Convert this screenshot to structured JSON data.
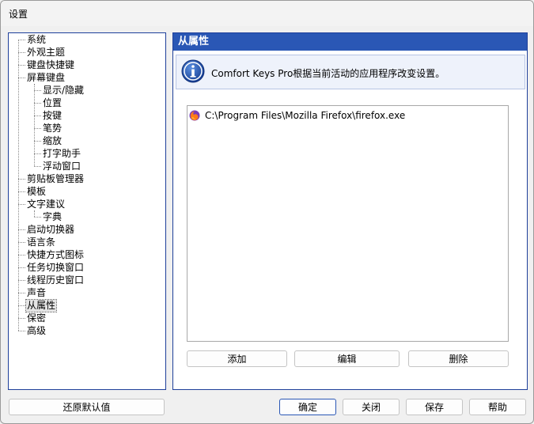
{
  "window": {
    "title": "设置"
  },
  "tree": {
    "items": [
      {
        "label": "系统",
        "level": 0
      },
      {
        "label": "外观主题",
        "level": 0
      },
      {
        "label": "键盘快捷键",
        "level": 0
      },
      {
        "label": "屏幕键盘",
        "level": 0
      },
      {
        "label": "显示/隐藏",
        "level": 1
      },
      {
        "label": "位置",
        "level": 1
      },
      {
        "label": "按键",
        "level": 1
      },
      {
        "label": "笔势",
        "level": 1
      },
      {
        "label": "缩放",
        "level": 1
      },
      {
        "label": "打字助手",
        "level": 1
      },
      {
        "label": "浮动窗口",
        "level": 1
      },
      {
        "label": "剪贴板管理器",
        "level": 0
      },
      {
        "label": "模板",
        "level": 0
      },
      {
        "label": "文字建议",
        "level": 0
      },
      {
        "label": "字典",
        "level": 1
      },
      {
        "label": "启动切换器",
        "level": 0
      },
      {
        "label": "语言条",
        "level": 0
      },
      {
        "label": "快捷方式图标",
        "level": 0
      },
      {
        "label": "任务切换窗口",
        "level": 0
      },
      {
        "label": "线程历史窗口",
        "level": 0
      },
      {
        "label": "声音",
        "level": 0
      },
      {
        "label": "从属性",
        "level": 0,
        "selected": true
      },
      {
        "label": "保密",
        "level": 0
      },
      {
        "label": "高级",
        "level": 0
      }
    ]
  },
  "panel": {
    "header": "从属性",
    "info_text": "Comfort Keys Pro根据当前活动的应用程序改变设置。",
    "list_items": [
      {
        "path": "C:\\Program Files\\Mozilla Firefox\\firefox.exe",
        "icon": "firefox-icon"
      }
    ],
    "buttons": {
      "add": "添加",
      "edit": "编辑",
      "delete": "删除"
    }
  },
  "footer": {
    "restore": "还原默认值",
    "ok": "确定",
    "close": "关闭",
    "save": "保存",
    "help": "帮助"
  },
  "colors": {
    "accent": "#2a57b5",
    "selected_bg": "#e5e5e5"
  }
}
